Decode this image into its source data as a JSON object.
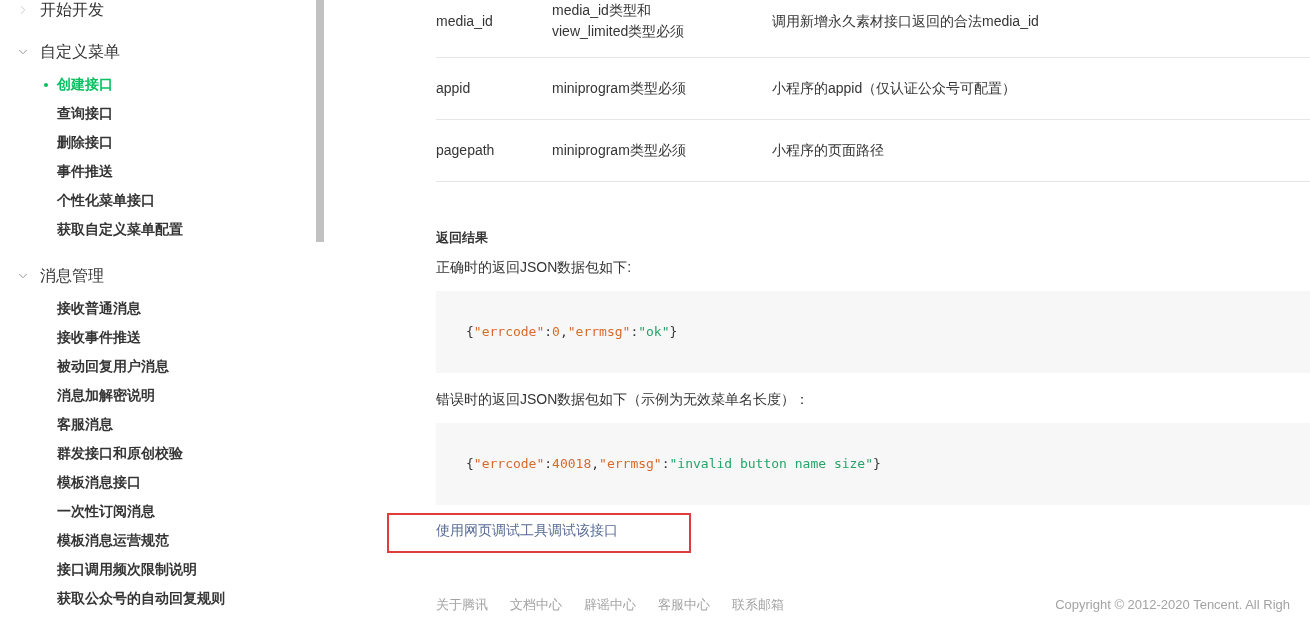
{
  "sidebar": {
    "sections": [
      {
        "title": "开始开发",
        "expanded": false
      },
      {
        "title": "自定义菜单",
        "expanded": true,
        "items": [
          {
            "label": "创建接口",
            "selected": true
          },
          {
            "label": "查询接口",
            "selected": false
          },
          {
            "label": "删除接口",
            "selected": false
          },
          {
            "label": "事件推送",
            "selected": false
          },
          {
            "label": "个性化菜单接口",
            "selected": false
          },
          {
            "label": "获取自定义菜单配置",
            "selected": false
          }
        ]
      },
      {
        "title": "消息管理",
        "expanded": true,
        "items": [
          {
            "label": "接收普通消息",
            "selected": false
          },
          {
            "label": "接收事件推送",
            "selected": false
          },
          {
            "label": "被动回复用户消息",
            "selected": false
          },
          {
            "label": "消息加解密说明",
            "selected": false
          },
          {
            "label": "客服消息",
            "selected": false
          },
          {
            "label": "群发接口和原创校验",
            "selected": false
          },
          {
            "label": "模板消息接口",
            "selected": false
          },
          {
            "label": "一次性订阅消息",
            "selected": false
          },
          {
            "label": "模板消息运营规范",
            "selected": false
          },
          {
            "label": "接口调用频次限制说明",
            "selected": false
          },
          {
            "label": "获取公众号的自动回复规则",
            "selected": false
          }
        ]
      }
    ]
  },
  "table": {
    "rows": [
      {
        "cells": [
          "media_id",
          "media_id类型和view_limited类型必须",
          "调用新增永久素材接口返回的合法media_id"
        ]
      },
      {
        "cells": [
          "appid",
          "miniprogram类型必须",
          "小程序的appid（仅认证公众号可配置）"
        ]
      },
      {
        "cells": [
          "pagepath",
          "miniprogram类型必须",
          "小程序的页面路径"
        ]
      }
    ]
  },
  "result": {
    "heading": "返回结果",
    "blocks": [
      {
        "kind": "text",
        "text": "正确时的返回JSON数据包如下:"
      },
      {
        "kind": "code",
        "tokens": [
          {
            "kind": "punct",
            "text": "{"
          },
          {
            "kind": "key",
            "text": "\"errcode\""
          },
          {
            "kind": "punct",
            "text": ":"
          },
          {
            "kind": "number",
            "text": "0"
          },
          {
            "kind": "punct",
            "text": ","
          },
          {
            "kind": "key",
            "text": "\"errmsg\""
          },
          {
            "kind": "punct",
            "text": ":"
          },
          {
            "kind": "string",
            "text": "\"ok\""
          },
          {
            "kind": "punct",
            "text": "}"
          }
        ]
      },
      {
        "kind": "text",
        "text": "错误时的返回JSON数据包如下（示例为无效菜单名长度）："
      },
      {
        "kind": "code",
        "tokens": [
          {
            "kind": "punct",
            "text": "{"
          },
          {
            "kind": "key",
            "text": "\"errcode\""
          },
          {
            "kind": "punct",
            "text": ":"
          },
          {
            "kind": "number",
            "text": "40018"
          },
          {
            "kind": "punct",
            "text": ","
          },
          {
            "kind": "key",
            "text": "\"errmsg\""
          },
          {
            "kind": "punct",
            "text": ":"
          },
          {
            "kind": "string",
            "text": "\"invalid button name size\""
          },
          {
            "kind": "punct",
            "text": "}"
          }
        ]
      }
    ]
  },
  "debug_link": {
    "label": "使用网页调试工具调试该接口",
    "highlighted": true
  },
  "footer": {
    "links": [
      "关于腾讯",
      "文档中心",
      "辟谣中心",
      "客服中心",
      "联系邮箱"
    ],
    "copyright": "Copyright © 2012-2020 Tencent. All Righ"
  }
}
